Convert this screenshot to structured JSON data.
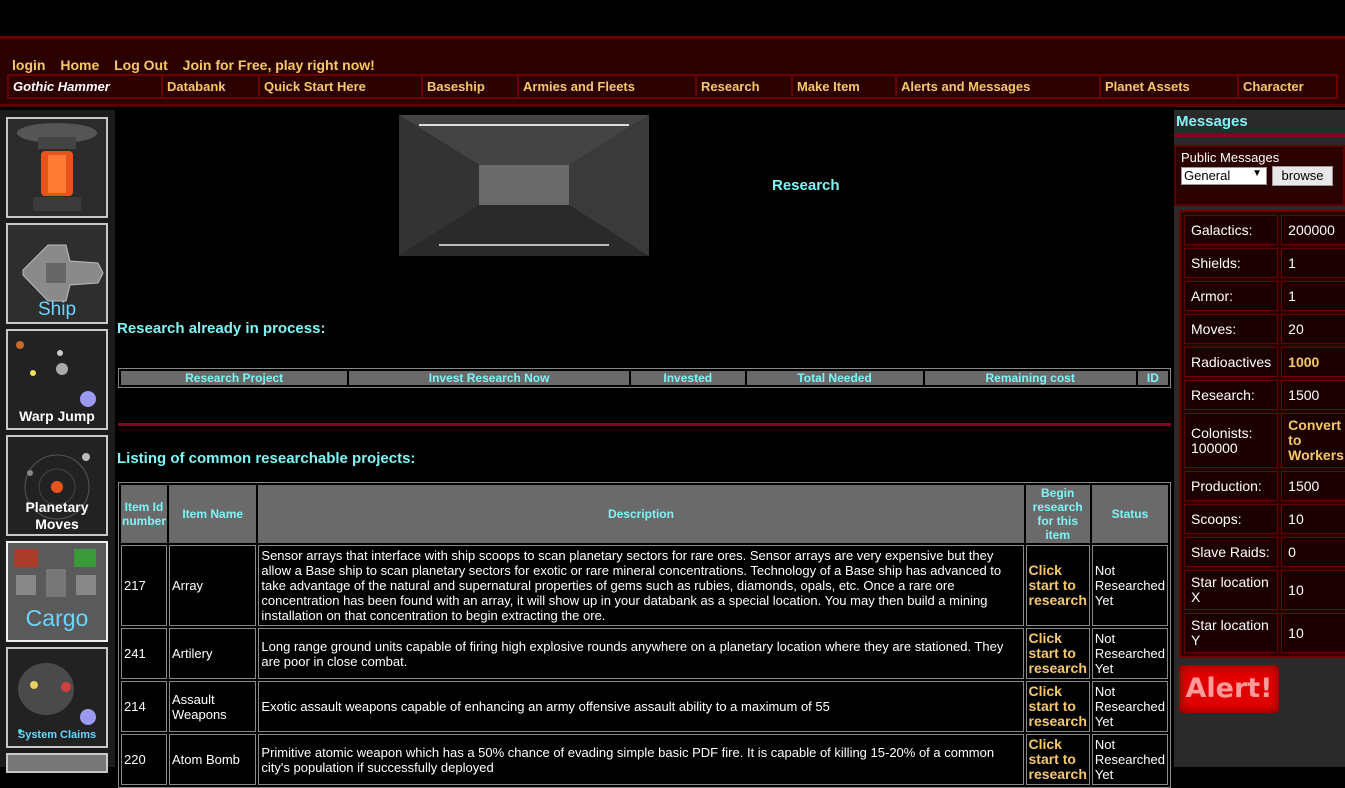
{
  "top_links": [
    "login",
    "Home",
    "Log Out",
    "Join for Free, play right now!"
  ],
  "nav": [
    "Gothic Hammer",
    "Databank",
    "Quick Start Here",
    "Baseship",
    "Armies and Fleets",
    "Research",
    "Make Item",
    "Alerts and Messages",
    "Planet Assets",
    "Character"
  ],
  "left_tiles": [
    {
      "label": ""
    },
    {
      "label": "Ship Systems"
    },
    {
      "label": "Warp Jump"
    },
    {
      "label": "Planetary Moves"
    },
    {
      "label": "Cargo"
    },
    {
      "label": "System Claims"
    }
  ],
  "page_title": "Research",
  "in_process": {
    "title": "Research already in process:",
    "headers": [
      "Research Project",
      "Invest Research Now",
      "Invested",
      "Total Needed",
      "Remaining cost",
      "ID"
    ]
  },
  "listing": {
    "title": "Listing of common researchable projects:",
    "headers": [
      "Item Id number",
      "Item Name",
      "Description",
      "Begin research for this item",
      "Status"
    ],
    "rows": [
      {
        "id": "217",
        "name": "Array",
        "desc": "Sensor arrays that interface with ship scoops to scan planetary sectors for rare ores. Sensor arrays are very expensive but they allow a Base ship to scan planetary sectors for exotic or rare mineral concentrations. Technology of a Base ship has advanced to take advantage of the natural and supernatural properties of gems such as rubies, diamonds, opals, etc. Once a rare ore concentration has been found with an array, it will show up in your databank as a special location. You may then build a mining installation on that concentration to begin extracting the ore.",
        "action": "Click start to research",
        "status": "Not Researched Yet"
      },
      {
        "id": "241",
        "name": "Artilery",
        "desc": "Long range ground units capable of firing high explosive rounds anywhere on a planetary location where they are stationed. They are poor in close combat.",
        "action": "Click start to research",
        "status": "Not Researched Yet"
      },
      {
        "id": "214",
        "name": "Assault Weapons",
        "desc": "Exotic assault weapons capable of enhancing an army offensive assault ability to a maximum of 55",
        "action": "Click start to research",
        "status": "Not Researched Yet"
      },
      {
        "id": "220",
        "name": "Atom Bomb",
        "desc": "Primitive atomic weapon which has a 50% chance of evading simple basic PDF fire. It is capable of killing 15-20% of a common city's population if successfully deployed",
        "action": "Click start to research",
        "status": "Not Researched Yet"
      }
    ]
  },
  "messages": {
    "title": "Messages",
    "public_label": "Public Messages",
    "select_value": "General",
    "browse_label": "browse"
  },
  "stats": [
    {
      "label": "Galactics:",
      "value": "200000"
    },
    {
      "label": "Shields:",
      "value": "1"
    },
    {
      "label": "Armor:",
      "value": "1"
    },
    {
      "label": "Moves:",
      "value": "20"
    },
    {
      "label": "Radioactives",
      "value": "1000",
      "gold": true
    },
    {
      "label": "Research:",
      "value": "1500"
    },
    {
      "label": "Colonists: 100000",
      "value": "Convert to Workers",
      "gold": true
    },
    {
      "label": "Production:",
      "value": "1500"
    },
    {
      "label": "Scoops:",
      "value": "10"
    },
    {
      "label": "Slave Raids:",
      "value": "0"
    },
    {
      "label": "Star location X",
      "value": "10"
    },
    {
      "label": "Star location Y",
      "value": "10"
    }
  ],
  "alert_label": "Alert!"
}
